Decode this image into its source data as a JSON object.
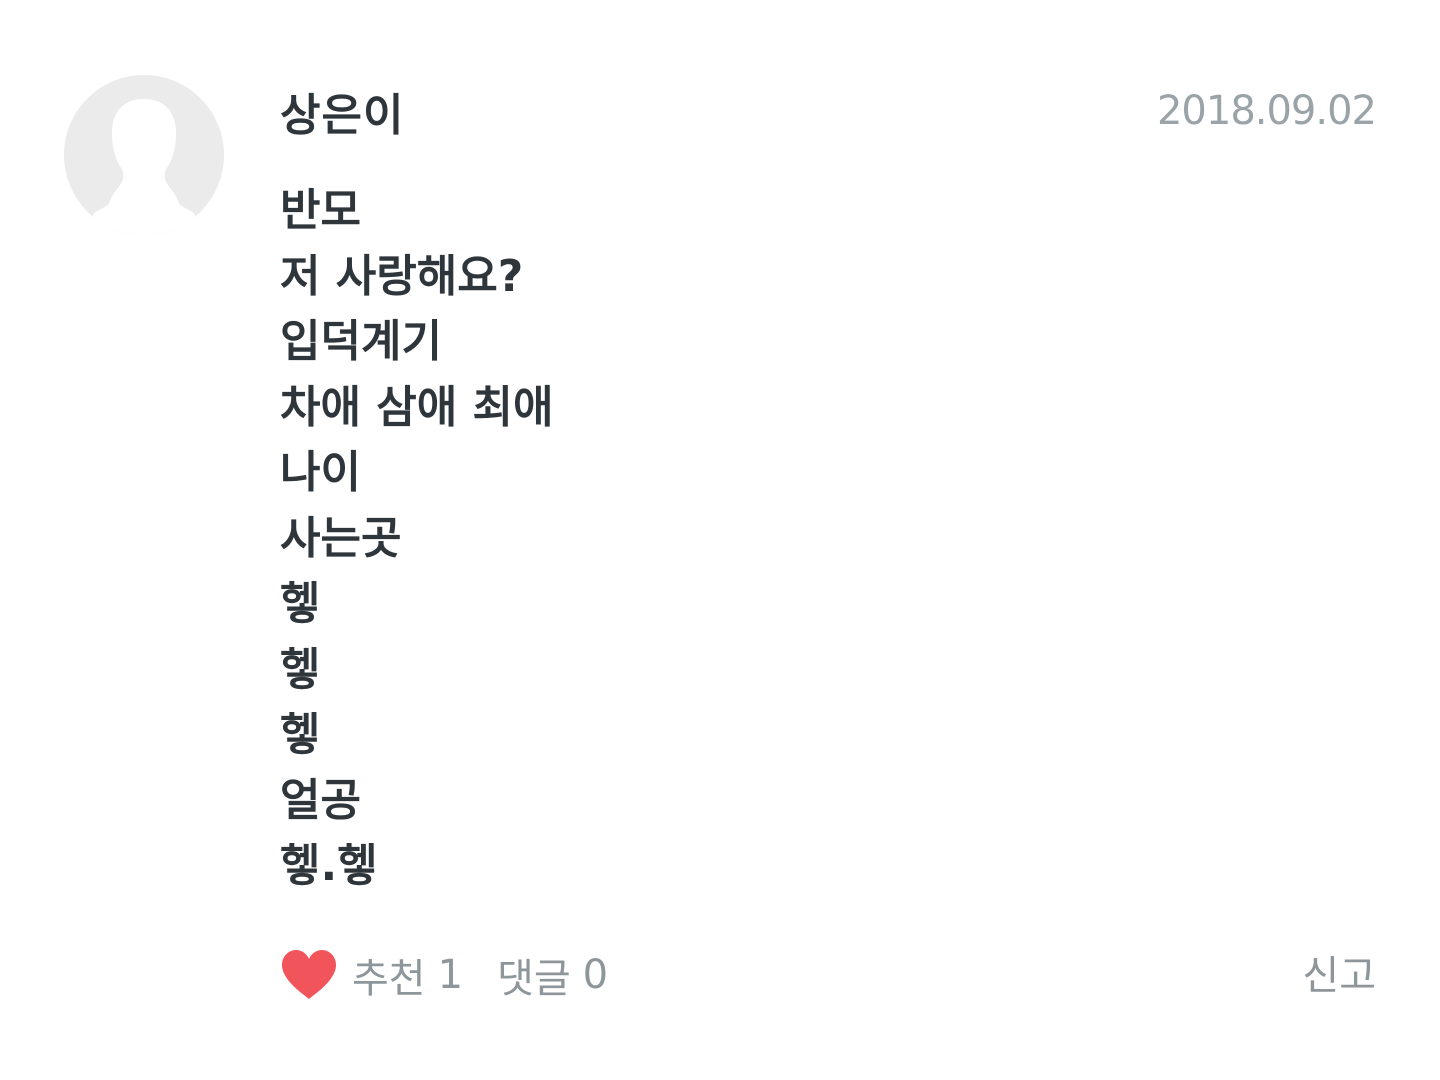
{
  "post": {
    "author": "상은이",
    "date": "2018.09.02",
    "lines": [
      "반모",
      "저 사랑해요?",
      "입덕계기",
      "차애 삼애 최애",
      "나이",
      "사는곳",
      "헿",
      "헿",
      "헿",
      "얼공",
      "헿.헿"
    ]
  },
  "footer": {
    "heart_icon": "heart-icon",
    "heart_color": "#f2545b",
    "likes_label": "추천",
    "likes_count": "1",
    "comments_label": "댓글",
    "comments_count": "0",
    "report_label": "신고"
  },
  "avatar": {
    "icon": "default-profile-icon",
    "bg_color": "#ebebeb",
    "fg_color": "#ffffff"
  }
}
